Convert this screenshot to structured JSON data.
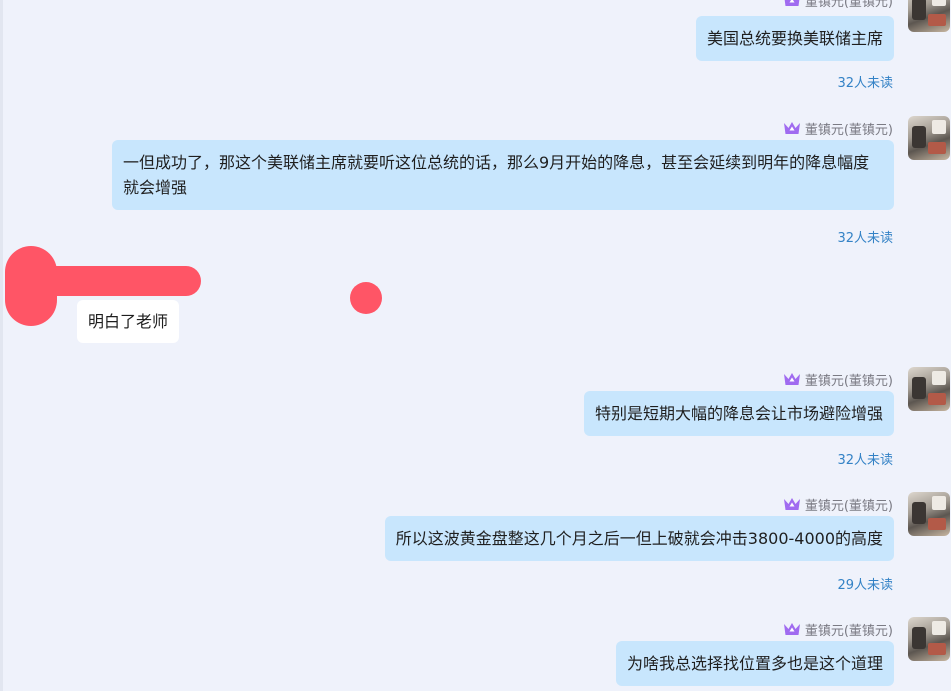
{
  "sender_name": "董镇元(董镇元)",
  "messages": [
    {
      "direction": "out",
      "text": "美国总统要换美联储主席",
      "unread": "32人未读"
    },
    {
      "direction": "out",
      "text": "一但成功了，那这个美联储主席就要听这位总统的话，那么9月开始的降息，甚至会延续到明年的降息幅度就会增强",
      "unread": "32人未读"
    },
    {
      "direction": "in",
      "text": "明白了老师"
    },
    {
      "direction": "out",
      "text": "特别是短期大幅的降息会让市场避险增强",
      "unread": "32人未读"
    },
    {
      "direction": "out",
      "text": "所以这波黄金盘整这几个月之后一但上破就会冲击3800-4000的高度",
      "unread": "29人未读"
    },
    {
      "direction": "out",
      "text": "为啥我总选择找位置多也是这个道理"
    }
  ],
  "colors": {
    "background": "#eff2fb",
    "outgoing_bubble": "#c8e6fd",
    "incoming_bubble": "#ffffff",
    "unread_text": "#3382c6",
    "redaction": "#ff5566",
    "crown": "#a06bf0"
  },
  "icons": {
    "crown": "crown-icon",
    "avatar": "avatar"
  }
}
